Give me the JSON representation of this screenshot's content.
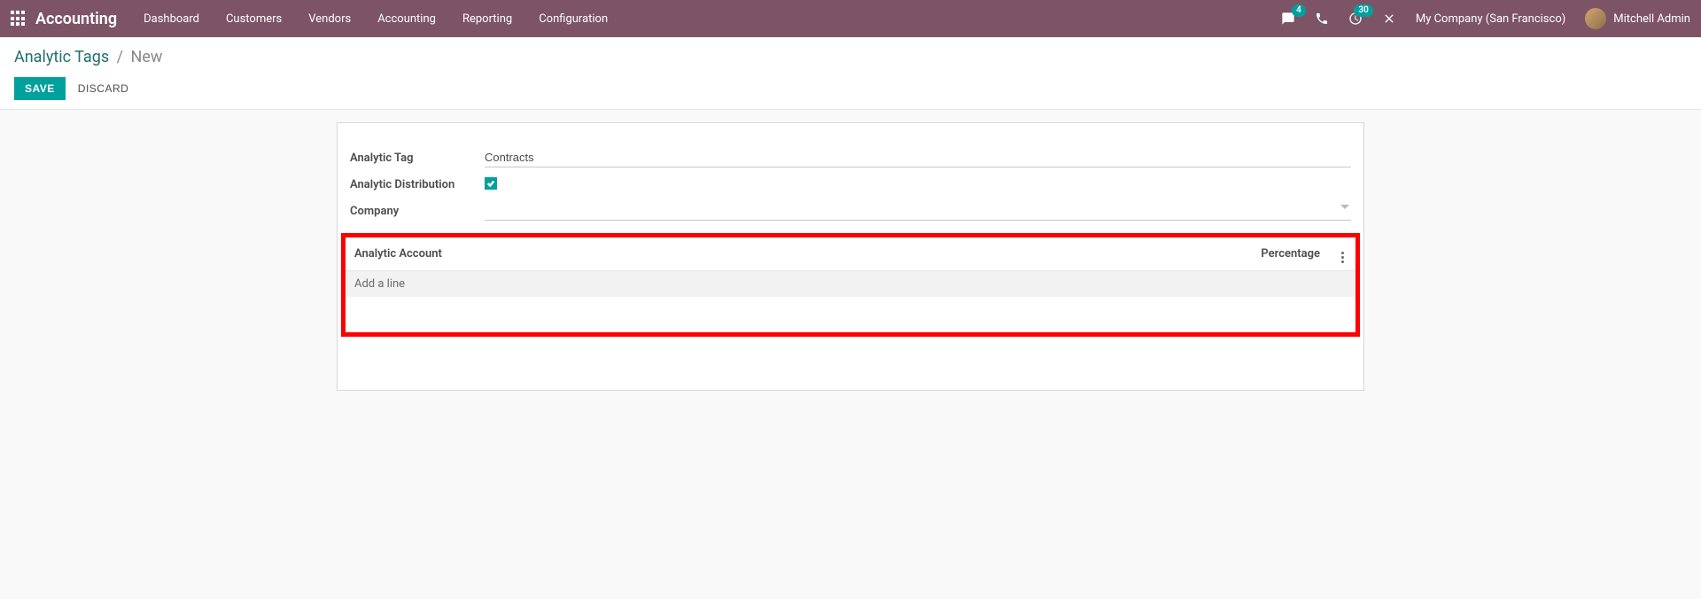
{
  "navbar": {
    "app_name": "Accounting",
    "menu": [
      "Dashboard",
      "Customers",
      "Vendors",
      "Accounting",
      "Reporting",
      "Configuration"
    ],
    "chat_badge": "4",
    "activity_badge": "30",
    "company": "My Company (San Francisco)",
    "user": "Mitchell Admin"
  },
  "breadcrumb": {
    "link": "Analytic Tags",
    "current": "New"
  },
  "buttons": {
    "save": "SAVE",
    "discard": "DISCARD"
  },
  "form": {
    "labels": {
      "tag": "Analytic Tag",
      "distribution": "Analytic Distribution",
      "company": "Company"
    },
    "values": {
      "tag": "Contracts",
      "distribution_checked": true,
      "company": ""
    }
  },
  "table": {
    "headers": {
      "account": "Analytic Account",
      "percentage": "Percentage"
    },
    "add_line": "Add a line"
  }
}
